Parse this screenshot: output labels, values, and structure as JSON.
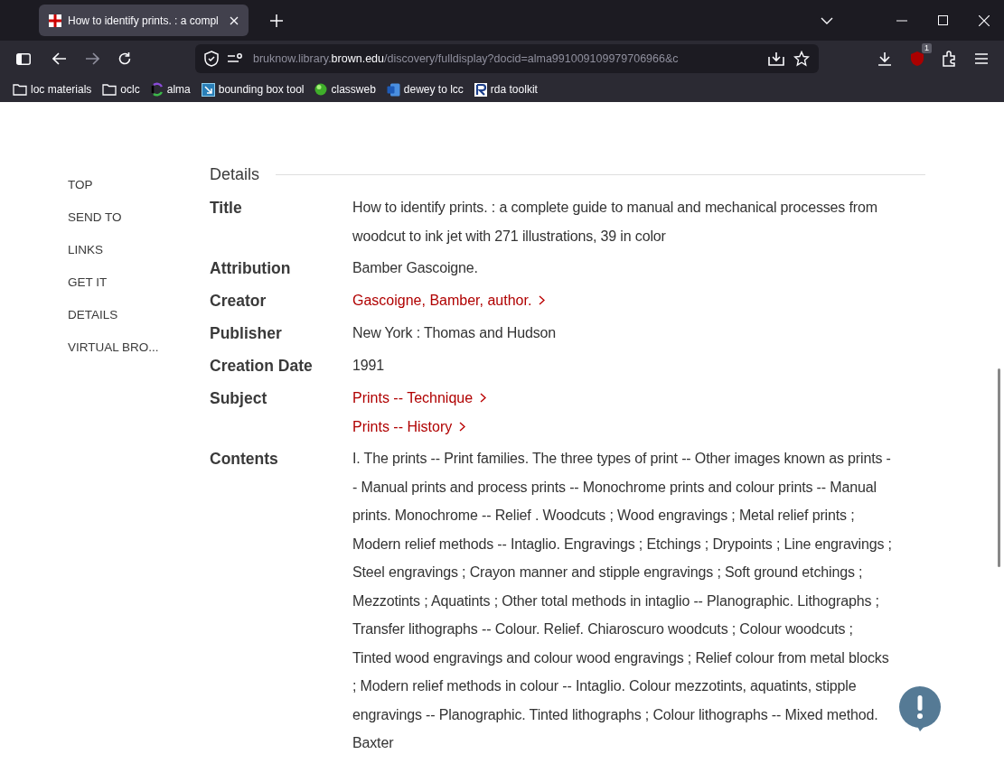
{
  "browser": {
    "tabs": [
      {
        "title": "How to identify prints. : a compl",
        "selected": true
      }
    ],
    "url": {
      "prefix": "bruknow.library.",
      "domain": "brown.edu",
      "path": "/discovery/fulldisplay?docid=alma991009109979706966&c"
    },
    "extension_badge": "1",
    "bookmarks": [
      {
        "label": "loc materials",
        "kind": "folder"
      },
      {
        "label": "oclc",
        "kind": "folder"
      },
      {
        "label": "alma",
        "kind": "alma"
      },
      {
        "label": "bounding box tool",
        "kind": "box"
      },
      {
        "label": "classweb",
        "kind": "ball"
      },
      {
        "label": "dewey to lcc",
        "kind": "word"
      },
      {
        "label": "rda toolkit",
        "kind": "rda"
      }
    ]
  },
  "side_nav": [
    {
      "label": "TOP"
    },
    {
      "label": "SEND TO"
    },
    {
      "label": "LINKS"
    },
    {
      "label": "GET IT"
    },
    {
      "label": "DETAILS"
    },
    {
      "label": "VIRTUAL BRO..."
    }
  ],
  "details": {
    "heading": "Details",
    "fields": [
      {
        "label": "Title",
        "kind": "text",
        "values": [
          "How to identify prints. : a complete guide to manual and mechanical processes from woodcut to ink jet with 271 illustrations, 39 in color"
        ]
      },
      {
        "label": "Attribution",
        "kind": "text",
        "values": [
          "Bamber Gascoigne."
        ]
      },
      {
        "label": "Creator",
        "kind": "link",
        "values": [
          "Gascoigne, Bamber, author."
        ]
      },
      {
        "label": "Publisher",
        "kind": "text",
        "values": [
          "New York : Thomas and Hudson"
        ]
      },
      {
        "label": "Creation Date",
        "kind": "text",
        "values": [
          "1991"
        ]
      },
      {
        "label": "Subject",
        "kind": "link",
        "values": [
          "Prints -- Technique",
          "Prints -- History"
        ]
      },
      {
        "label": "Contents",
        "kind": "text",
        "values": [
          "I. The prints -- Print families. The three types of print -- Other images known as prints -- Manual prints and process prints -- Monochrome prints and colour prints -- Manual prints. Monochrome -- Relief . Woodcuts ; Wood engravings ; Metal relief prints ; Modern relief methods -- Intaglio. Engravings ; Etchings ; Drypoints ; Line engravings ; Steel engravings ; Crayon manner and stipple engravings ; Soft ground etchings ; Mezzotints ; Aquatints ; Other total methods in intaglio -- Planographic. Lithographs ; Transfer lithographs -- Colour. Relief. Chiaroscuro woodcuts ; Colour woodcuts ; Tinted wood engravings and colour wood engravings ; Relief colour from metal blocks ; Modern relief methods in colour -- Intaglio. Colour mezzotints, aquatints, stipple engravings -- Planographic. Tinted lithographs ; Colour lithographs -- Mixed method. Baxter"
        ]
      }
    ]
  }
}
